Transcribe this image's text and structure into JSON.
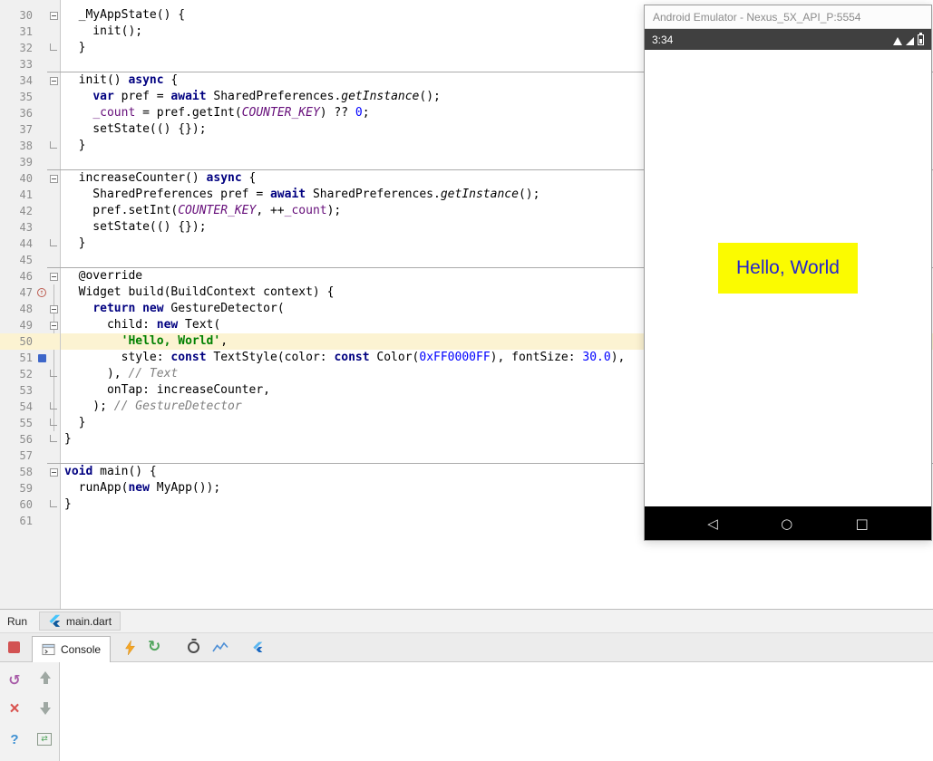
{
  "colors": {
    "keyword": "#000080",
    "string": "#008000",
    "number": "#0000FF",
    "comment": "#808080",
    "field": "#660E7A",
    "caret_line": "#FCF3D2",
    "bookmark": "#3D66C9",
    "hello_box": "#FBFB00",
    "hello_text": "#2626CE",
    "stop_button": "#D25252",
    "hot_reload": "#F6A623",
    "hot_restart": "#4FA45B",
    "status_bar_bg": "#404040"
  },
  "icons": {
    "rerun_glyph": "↺",
    "restart_glyph": "↻",
    "close_glyph": "×",
    "help_glyph": "?",
    "settings_glyph": "⇄",
    "nav_back": "◁",
    "nav_home": "○",
    "nav_recents": "□"
  },
  "editor": {
    "caret_line": 50,
    "lines": [
      {
        "n": 30,
        "fold": "start",
        "tokens": [
          [
            "pln",
            "  _MyAppState() {"
          ]
        ]
      },
      {
        "n": 31,
        "tokens": [
          [
            "pln",
            "    init();"
          ]
        ]
      },
      {
        "n": 32,
        "fold": "end",
        "tokens": [
          [
            "pln",
            "  }"
          ]
        ]
      },
      {
        "n": 33,
        "tokens": []
      },
      {
        "n": 34,
        "sep": true,
        "fold": "start",
        "tokens": [
          [
            "pln",
            "  init() "
          ],
          [
            "kw",
            "async"
          ],
          [
            "pln",
            " {"
          ]
        ]
      },
      {
        "n": 35,
        "tokens": [
          [
            "pln",
            "    "
          ],
          [
            "kw",
            "var"
          ],
          [
            "pln",
            " pref = "
          ],
          [
            "kw",
            "await"
          ],
          [
            "pln",
            " SharedPreferences."
          ],
          [
            "stc",
            "getInstance"
          ],
          [
            "pln",
            "();"
          ]
        ]
      },
      {
        "n": 36,
        "tokens": [
          [
            "pln",
            "    "
          ],
          [
            "fld",
            "_count"
          ],
          [
            "pln",
            " = pref.getInt("
          ],
          [
            "cns",
            "COUNTER_KEY"
          ],
          [
            "pln",
            ") ?? "
          ],
          [
            "num",
            "0"
          ],
          [
            "pln",
            ";"
          ]
        ]
      },
      {
        "n": 37,
        "tokens": [
          [
            "pln",
            "    setState(() {});"
          ]
        ]
      },
      {
        "n": 38,
        "fold": "end",
        "tokens": [
          [
            "pln",
            "  }"
          ]
        ]
      },
      {
        "n": 39,
        "tokens": []
      },
      {
        "n": 40,
        "sep": true,
        "fold": "start",
        "tokens": [
          [
            "pln",
            "  increaseCounter() "
          ],
          [
            "kw",
            "async"
          ],
          [
            "pln",
            " {"
          ]
        ]
      },
      {
        "n": 41,
        "tokens": [
          [
            "pln",
            "    SharedPreferences pref = "
          ],
          [
            "kw",
            "await"
          ],
          [
            "pln",
            " SharedPreferences."
          ],
          [
            "stc",
            "getInstance"
          ],
          [
            "pln",
            "();"
          ]
        ]
      },
      {
        "n": 42,
        "tokens": [
          [
            "pln",
            "    pref.setInt("
          ],
          [
            "cns",
            "COUNTER_KEY"
          ],
          [
            "pln",
            ", ++"
          ],
          [
            "fld",
            "_count"
          ],
          [
            "pln",
            ");"
          ]
        ]
      },
      {
        "n": 43,
        "tokens": [
          [
            "pln",
            "    setState(() {});"
          ]
        ]
      },
      {
        "n": 44,
        "fold": "end",
        "tokens": [
          [
            "pln",
            "  }"
          ]
        ]
      },
      {
        "n": 45,
        "tokens": []
      },
      {
        "n": 46,
        "sep": true,
        "fold": "start",
        "tokens": [
          [
            "pln",
            "  @override"
          ]
        ]
      },
      {
        "n": 47,
        "icon": "override",
        "tokens": [
          [
            "pln",
            "  Widget build(BuildContext context) {"
          ]
        ]
      },
      {
        "n": 48,
        "fold": "start",
        "tokens": [
          [
            "pln",
            "    "
          ],
          [
            "kw",
            "return"
          ],
          [
            "pln",
            " "
          ],
          [
            "kw",
            "new"
          ],
          [
            "pln",
            " GestureDetector("
          ]
        ]
      },
      {
        "n": 49,
        "fold": "start",
        "tokens": [
          [
            "pln",
            "      child: "
          ],
          [
            "kw",
            "new"
          ],
          [
            "pln",
            " Text("
          ]
        ]
      },
      {
        "n": 50,
        "tokens": [
          [
            "pln",
            "        "
          ],
          [
            "str",
            "'Hello, World'"
          ],
          [
            "pln",
            ","
          ]
        ]
      },
      {
        "n": 51,
        "icon": "bookmark",
        "tokens": [
          [
            "pln",
            "        style: "
          ],
          [
            "kw",
            "const"
          ],
          [
            "pln",
            " TextStyle(color: "
          ],
          [
            "kw",
            "const"
          ],
          [
            "pln",
            " Color("
          ],
          [
            "num",
            "0xFF0000FF"
          ],
          [
            "pln",
            "), fontSize: "
          ],
          [
            "num",
            "30.0"
          ],
          [
            "pln",
            "),"
          ]
        ]
      },
      {
        "n": 52,
        "fold": "end",
        "tokens": [
          [
            "pln",
            "      ), "
          ],
          [
            "cmt",
            "// Text"
          ]
        ]
      },
      {
        "n": 53,
        "tokens": [
          [
            "pln",
            "      onTap: increaseCounter,"
          ]
        ]
      },
      {
        "n": 54,
        "fold": "end",
        "tokens": [
          [
            "pln",
            "    ); "
          ],
          [
            "cmt",
            "// GestureDetector"
          ]
        ]
      },
      {
        "n": 55,
        "fold": "end",
        "tokens": [
          [
            "pln",
            "  }"
          ]
        ]
      },
      {
        "n": 56,
        "fold": "end",
        "tokens": [
          [
            "pln",
            "}"
          ]
        ]
      },
      {
        "n": 57,
        "tokens": []
      },
      {
        "n": 58,
        "sep": true,
        "fold": "start",
        "tokens": [
          [
            "kw",
            "void"
          ],
          [
            "pln",
            " main() {"
          ]
        ]
      },
      {
        "n": 59,
        "tokens": [
          [
            "pln",
            "  runApp("
          ],
          [
            "kw",
            "new"
          ],
          [
            "pln",
            " MyApp());"
          ]
        ]
      },
      {
        "n": 60,
        "fold": "end",
        "tokens": [
          [
            "pln",
            "}"
          ]
        ]
      },
      {
        "n": 61,
        "tokens": []
      }
    ]
  },
  "emulator": {
    "window_title": "Android Emulator - Nexus_5X_API_P:5554",
    "status_bar": {
      "time": "3:34"
    },
    "screen": {
      "message": "Hello, World"
    }
  },
  "run_panel": {
    "title": "Run",
    "tab_label": "main.dart",
    "console_tab_label": "Console"
  }
}
